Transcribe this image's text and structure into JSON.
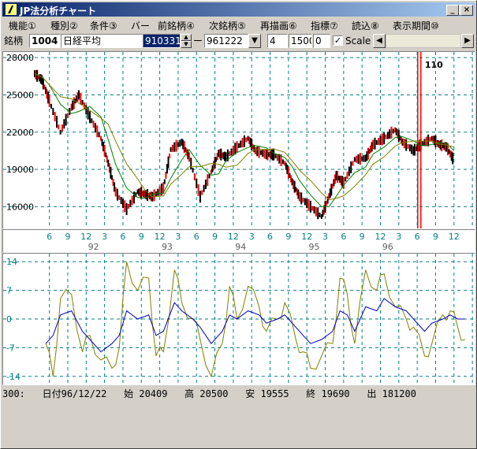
{
  "window": {
    "title": "JP法分析チャート",
    "controls": {
      "minimize": "_",
      "maximize": "□",
      "close": "×"
    }
  },
  "menu": [
    "機能①",
    "種別②",
    "条件③",
    "バー",
    "前銘柄④",
    "次銘柄⑤",
    "再描画⑥",
    "指標⑦",
    "読込⑧",
    "表示期間⑩"
  ],
  "toolbar": {
    "label": "銘柄",
    "code": "1004",
    "name": "日経平均",
    "start_date": "910331",
    "separator": "ー",
    "end_date": "961222",
    "param1": "4",
    "param2": "1500",
    "param3": "0",
    "scale_checked": true,
    "scale_label": "Scale"
  },
  "colors": {
    "grid": "#008080",
    "price_up": "#ff0000",
    "price_down": "#000000",
    "ma_short": "#008000",
    "ma_long": "#808000",
    "marker": "#ff0000",
    "osc_fast": "#0000c0",
    "osc_slow": "#808000"
  },
  "price_chart": {
    "y_labels": [
      "28000",
      "25000",
      "22000",
      "19000",
      "16000"
    ],
    "y_values": [
      28000,
      25000,
      22000,
      19000,
      16000
    ],
    "ylim": [
      14500,
      28200
    ],
    "markers": [
      "110",
      "110",
      "110"
    ],
    "marker_positions": [
      5.25,
      9.45,
      10.35
    ]
  },
  "time_axis": {
    "months": [
      "6",
      "9",
      "12",
      "3",
      "6",
      "9",
      "12",
      "3",
      "6",
      "9",
      "12",
      "3",
      "6",
      "9",
      "12",
      "3",
      "6",
      "9",
      "12",
      "3",
      "6",
      "9",
      "12"
    ],
    "years": [
      "92",
      "93",
      "94",
      "95",
      "96"
    ],
    "span": [
      "1991-04",
      "1996-12"
    ]
  },
  "oscillator": {
    "y_labels": [
      "14",
      "7",
      "0",
      "-7",
      "-14"
    ],
    "y_values": [
      14,
      7,
      0,
      -7,
      -14
    ]
  },
  "status": {
    "index": "300:",
    "date_label": "日付",
    "date": "96/12/22",
    "open_label": "始",
    "open": "20409",
    "high_label": "高",
    "high": "20500",
    "low_label": "安",
    "low": "19555",
    "close_label": "終",
    "close": "19690",
    "volume_label": "出",
    "volume": "181200"
  },
  "chart_data": [
    {
      "type": "line",
      "title": "日経平均",
      "x_unit": "years since 1991-04",
      "series": [
        {
          "x": [
            0,
            0.1,
            0.2,
            0.35,
            0.5,
            0.6,
            0.75,
            0.9,
            1.0,
            1.1,
            1.25,
            1.4,
            1.5,
            1.6,
            1.75,
            1.85,
            2.0,
            2.1,
            2.25,
            2.4,
            2.5,
            2.6,
            2.75,
            2.9,
            3.0,
            3.15,
            3.25,
            3.4,
            3.5,
            3.6,
            3.75,
            3.9,
            4.0,
            4.1,
            4.2,
            4.35,
            4.5,
            4.6,
            4.75,
            4.9,
            5.0,
            5.15,
            5.25,
            5.4,
            5.5,
            5.6,
            5.7
          ],
          "values": [
            26700,
            26200,
            24500,
            22000,
            24000,
            25000,
            23200,
            21500,
            19500,
            17200,
            15800,
            17200,
            17000,
            16800,
            17500,
            20600,
            21200,
            20000,
            16800,
            18800,
            20300,
            20000,
            20800,
            21500,
            20500,
            20200,
            20200,
            19500,
            18000,
            16800,
            16000,
            15200,
            16800,
            18500,
            17900,
            19800,
            19900,
            21000,
            21500,
            22200,
            21200,
            20500,
            21000,
            21500,
            21000,
            20800,
            19700
          ]
        }
      ],
      "ylim": [
        14500,
        28200
      ]
    },
    {
      "type": "line",
      "title": "",
      "x_unit": "years since 1991-04",
      "series": [
        {
          "values": [
            -6,
            -4,
            1,
            2,
            -3,
            -5,
            -8,
            -6,
            -4,
            2,
            0,
            1,
            -4,
            -3,
            4,
            2,
            0,
            -2,
            -6,
            -3,
            1,
            0,
            2,
            1,
            -1,
            0,
            1,
            -2,
            -4,
            -6,
            -5,
            -3,
            2,
            1,
            -3,
            3,
            2,
            5,
            3,
            2,
            0,
            -3,
            -1,
            0,
            1,
            0,
            0
          ]
        },
        {
          "values": [
            -6,
            -14,
            5,
            6,
            -8,
            -4,
            -10,
            -12,
            -7,
            14,
            7,
            10,
            -9,
            -8,
            12,
            4,
            0,
            -5,
            -14,
            -6,
            8,
            0,
            8,
            3,
            -3,
            0,
            4,
            -5,
            -8,
            -12,
            -9,
            -6,
            10,
            6,
            -6,
            12,
            7,
            11,
            3,
            0,
            -2,
            -9,
            -6,
            1,
            2,
            -2,
            -5
          ]
        }
      ],
      "ylim": [
        -14,
        14
      ]
    }
  ]
}
